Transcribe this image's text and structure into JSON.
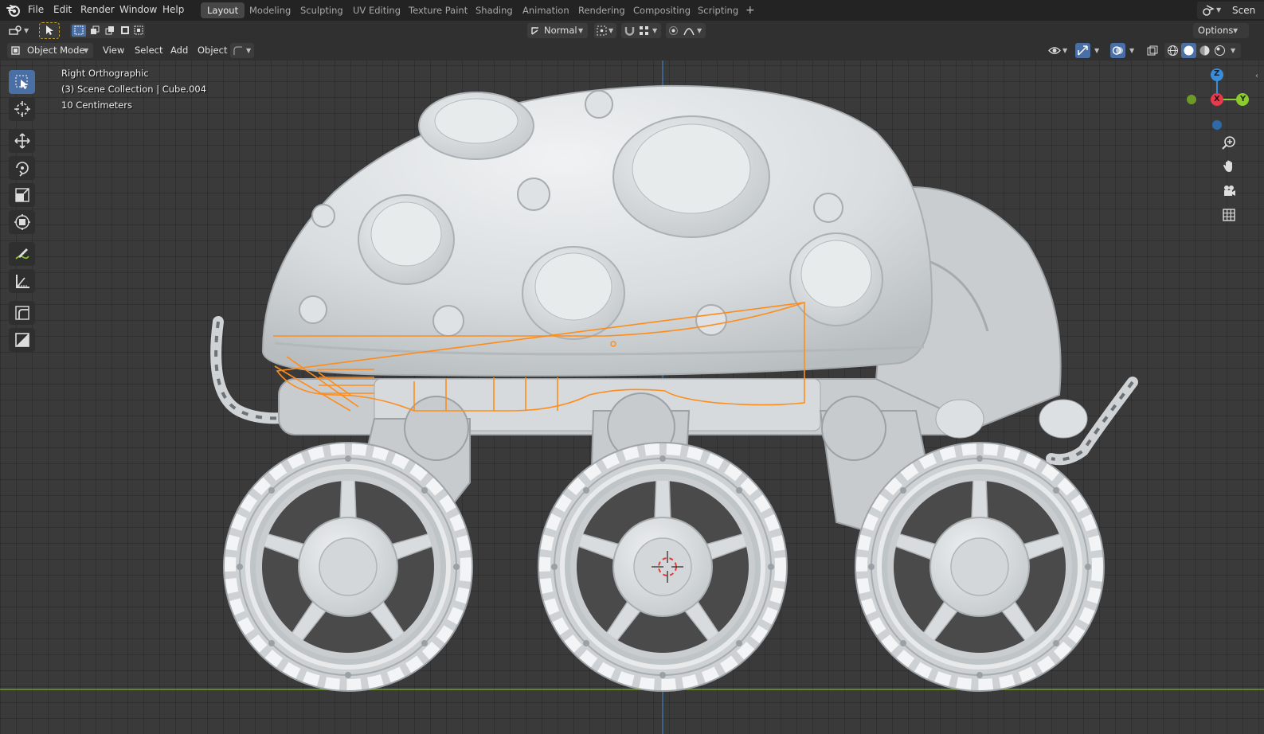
{
  "menubar": {
    "menus": [
      "File",
      "Edit",
      "Render",
      "Window",
      "Help"
    ],
    "workspaces": [
      "Layout",
      "Modeling",
      "Sculpting",
      "UV Editing",
      "Texture Paint",
      "Shading",
      "Animation",
      "Rendering",
      "Compositing",
      "Scripting"
    ],
    "active_workspace": "Layout",
    "add_workspace": "+",
    "scene_label": "Scen"
  },
  "header": {
    "orientation": "Normal",
    "options": "Options",
    "mode": "Object Mode",
    "view": "View",
    "select": "Select",
    "add": "Add",
    "object": "Object"
  },
  "viewport": {
    "view_name": "Right Orthographic",
    "collection": "(3) Scene Collection | Cube.004",
    "scale": "10 Centimeters",
    "gizmo": {
      "z": "Z",
      "x": "X",
      "y": "Y"
    }
  },
  "colors": {
    "accent": "#4a6fa5",
    "selection": "#ff8c1a",
    "x_axis": "#e8394d",
    "y_axis": "#8bcb2d",
    "z_axis": "#3a8ddb"
  }
}
